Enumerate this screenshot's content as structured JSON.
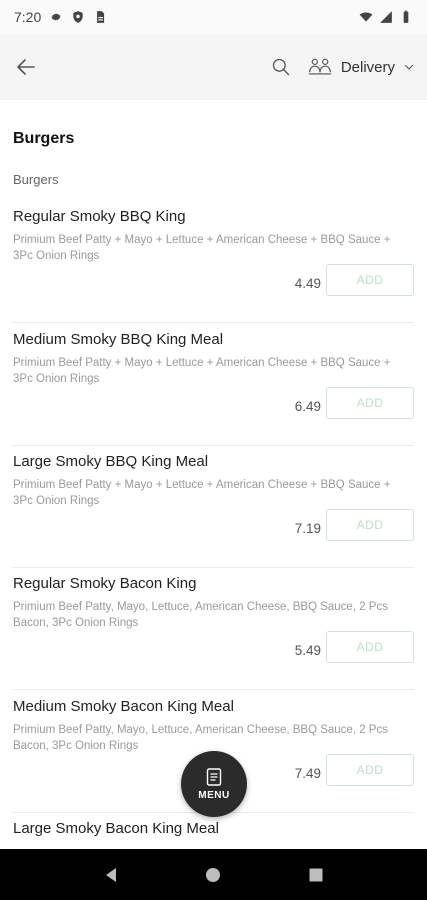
{
  "status_bar": {
    "time": "7:20",
    "left_icons": [
      "gear-icon",
      "shield-icon",
      "sim-card-icon"
    ],
    "right_icons": [
      "wifi-icon",
      "signal-icon",
      "battery-icon"
    ]
  },
  "app_bar": {
    "back_icon": "arrow-left-icon",
    "search_icon": "search-icon",
    "delivery_icon": "delivery-riders-icon",
    "delivery_label": "Delivery",
    "chevron_icon": "chevron-down-icon"
  },
  "menu": {
    "section_title": "Burgers",
    "subcategory": "Burgers",
    "add_label": "ADD",
    "items": [
      {
        "name": "Regular Smoky BBQ King",
        "description": "Primium Beef Patty + Mayo + Lettuce + American Cheese + BBQ Sauce + 3Pc Onion Rings",
        "price": "4.49"
      },
      {
        "name": "Medium Smoky BBQ King Meal",
        "description": "Primium Beef Patty + Mayo + Lettuce + American Cheese + BBQ Sauce + 3Pc Onion Rings",
        "price": "6.49"
      },
      {
        "name": "Large Smoky BBQ King Meal",
        "description": "Primium Beef Patty + Mayo + Lettuce + American Cheese + BBQ Sauce + 3Pc Onion Rings",
        "price": "7.19"
      },
      {
        "name": "Regular Smoky Bacon King",
        "description": "Primium Beef Patty, Mayo, Lettuce, American Cheese,  BBQ Sauce, 2 Pcs Bacon, 3Pc Onion Rings",
        "price": "5.49"
      },
      {
        "name": "Medium Smoky Bacon King Meal",
        "description": "Primium Beef Patty, Mayo, Lettuce, American Cheese,  BBQ Sauce, 2 Pcs Bacon, 3Pc Onion Rings",
        "price": "7.49"
      },
      {
        "name": "Large Smoky Bacon King Meal",
        "description": "",
        "price": ""
      }
    ]
  },
  "fab": {
    "icon": "menu-book-icon",
    "label": "MENU"
  },
  "nav_bar": {
    "icons": [
      "back-triangle-icon",
      "home-circle-icon",
      "recents-square-icon"
    ]
  },
  "colors": {
    "add_border": "#cfe6d4",
    "add_text": "#bde0c6",
    "app_bar_bg": "#f5f5f5",
    "fab_bg": "#2b2b2b"
  }
}
